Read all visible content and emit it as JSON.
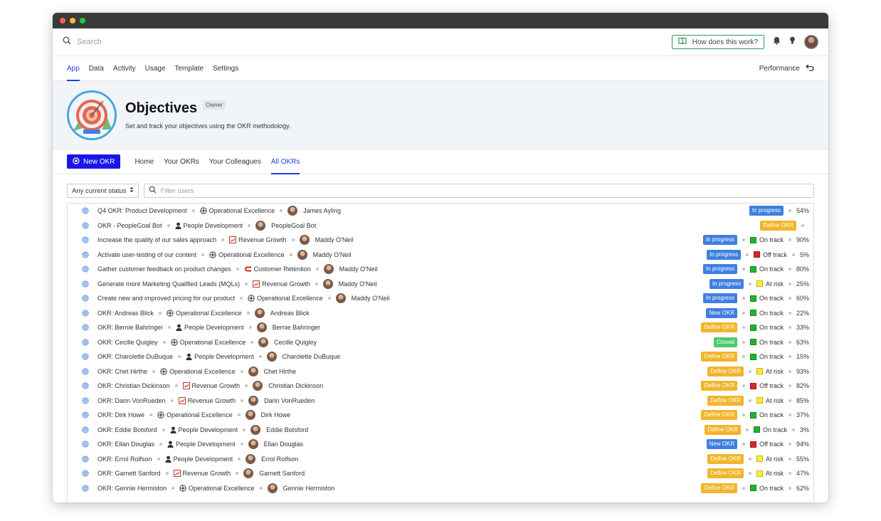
{
  "search": {
    "placeholder": "Search"
  },
  "header": {
    "help_label": "How does this work?"
  },
  "app_tabs": [
    "App",
    "Data",
    "Activity",
    "Usage",
    "Template",
    "Settings"
  ],
  "performance_label": "Performance",
  "hero": {
    "title": "Objectives",
    "badge": "Owner",
    "subtitle": "Set and track your objectives using the OKR methodology."
  },
  "new_okr_label": "New OKR",
  "sub_tabs": [
    "Home",
    "Your OKRs",
    "Your Colleagues",
    "All OKRs"
  ],
  "filters": {
    "status": "Any current status",
    "users_placeholder": "Filter users"
  },
  "colors": {
    "accent": "#1e3ee6",
    "primary_button": "#1b16e8",
    "in_progress": "#3f7fe0",
    "define_okr": "#f2b52b",
    "closed": "#4cc96b"
  },
  "rows": [
    {
      "title": "Q4 OKR: Product Development",
      "category": "Operational Excellence",
      "cat_icon": "gear-icon",
      "user": "James Ayling",
      "status": "In progress",
      "status_type": "prog",
      "track": "",
      "track_color": "",
      "pct": "54%"
    },
    {
      "title": "OKR - PeopleGoal Bot",
      "category": "People Development",
      "cat_icon": "person-icon",
      "user": "PeopleGoal Bot",
      "status": "Define OKR",
      "status_type": "def",
      "track": "",
      "track_color": "",
      "pct": ""
    },
    {
      "title": "Increase the quality of our sales approach",
      "category": "Revenue Growth",
      "cat_icon": "chart-icon",
      "user": "Maddy O'Neil",
      "status": "In progress",
      "status_type": "prog",
      "track": "On track",
      "track_color": "green",
      "pct": "90%"
    },
    {
      "title": "Activate user-testing of our content",
      "category": "Operational Excellence",
      "cat_icon": "gear-icon",
      "user": "Maddy O'Neil",
      "status": "In progress",
      "status_type": "prog",
      "track": "Off track",
      "track_color": "red",
      "pct": "5%"
    },
    {
      "title": "Gather customer feedback on product changes",
      "category": "Customer Retention",
      "cat_icon": "magnet-icon",
      "user": "Maddy O'Neil",
      "status": "In progress",
      "status_type": "prog",
      "track": "On track",
      "track_color": "green",
      "pct": "80%"
    },
    {
      "title": "Generate more Marketing Qualified Leads (MQLs)",
      "category": "Revenue Growth",
      "cat_icon": "chart-icon",
      "user": "Maddy O'Neil",
      "status": "In progress",
      "status_type": "prog",
      "track": "At risk",
      "track_color": "yellow",
      "pct": "25%"
    },
    {
      "title": "Create new and improved pricing for our product",
      "category": "Operational Excellence",
      "cat_icon": "gear-icon",
      "user": "Maddy O'Neil",
      "status": "In progress",
      "status_type": "prog",
      "track": "On track",
      "track_color": "green",
      "pct": "60%"
    },
    {
      "title": "OKR: Andreas Blick",
      "category": "Operational Excellence",
      "cat_icon": "gear-icon",
      "user": "Andreas Blick",
      "status": "New OKR",
      "status_type": "new",
      "track": "On track",
      "track_color": "green",
      "pct": "22%"
    },
    {
      "title": "OKR: Bernie Bahringer",
      "category": "People Development",
      "cat_icon": "person-icon",
      "user": "Bernie Bahringer",
      "status": "Define OKR",
      "status_type": "def",
      "track": "On track",
      "track_color": "green",
      "pct": "33%"
    },
    {
      "title": "OKR: Cecille Quigley",
      "category": "Operational Excellence",
      "cat_icon": "gear-icon",
      "user": "Cecille Quigley",
      "status": "Closed",
      "status_type": "closed",
      "track": "On track",
      "track_color": "green",
      "pct": "63%"
    },
    {
      "title": "OKR: Charolette DuBuque",
      "category": "People Development",
      "cat_icon": "person-icon",
      "user": "Charolette DuBuque",
      "status": "Define OKR",
      "status_type": "def",
      "track": "On track",
      "track_color": "green",
      "pct": "15%"
    },
    {
      "title": "OKR: Chet Hirthe",
      "category": "Operational Excellence",
      "cat_icon": "gear-icon",
      "user": "Chet Hirthe",
      "status": "Define OKR",
      "status_type": "def",
      "track": "At risk",
      "track_color": "yellow",
      "pct": "93%"
    },
    {
      "title": "OKR: Christian Dickinson",
      "category": "Revenue Growth",
      "cat_icon": "chart-icon",
      "user": "Christian Dickinson",
      "status": "Define OKR",
      "status_type": "def",
      "track": "Off track",
      "track_color": "red",
      "pct": "82%"
    },
    {
      "title": "OKR: Darin VonRueden",
      "category": "Revenue Growth",
      "cat_icon": "chart-icon",
      "user": "Darin VonRueden",
      "status": "Define OKR",
      "status_type": "def",
      "track": "At risk",
      "track_color": "yellow",
      "pct": "85%"
    },
    {
      "title": "OKR: Dirk Howe",
      "category": "Operational Excellence",
      "cat_icon": "gear-icon",
      "user": "Dirk Howe",
      "status": "Define OKR",
      "status_type": "def",
      "track": "On track",
      "track_color": "green",
      "pct": "37%"
    },
    {
      "title": "OKR: Eddie Botsford",
      "category": "People Development",
      "cat_icon": "person-icon",
      "user": "Eddie Botsford",
      "status": "Define OKR",
      "status_type": "def",
      "track": "On track",
      "track_color": "green",
      "pct": "3%"
    },
    {
      "title": "OKR: Ellan Douglas",
      "category": "People Development",
      "cat_icon": "person-icon",
      "user": "Ellan Douglas",
      "status": "New OKR",
      "status_type": "new",
      "track": "Off track",
      "track_color": "red",
      "pct": "94%"
    },
    {
      "title": "OKR: Errol Rolfson",
      "category": "People Development",
      "cat_icon": "person-icon",
      "user": "Errol Rolfson",
      "status": "Define OKR",
      "status_type": "def",
      "track": "At risk",
      "track_color": "yellow",
      "pct": "55%"
    },
    {
      "title": "OKR: Garnett Sanford",
      "category": "Revenue Growth",
      "cat_icon": "chart-icon",
      "user": "Garnett Sanford",
      "status": "Define OKR",
      "status_type": "def",
      "track": "At risk",
      "track_color": "yellow",
      "pct": "47%"
    },
    {
      "title": "OKR: Gennie Hermiston",
      "category": "Operational Excellence",
      "cat_icon": "gear-icon",
      "user": "Gennie Hermiston",
      "status": "Define OKR",
      "status_type": "def",
      "track": "On track",
      "track_color": "green",
      "pct": "62%"
    }
  ]
}
